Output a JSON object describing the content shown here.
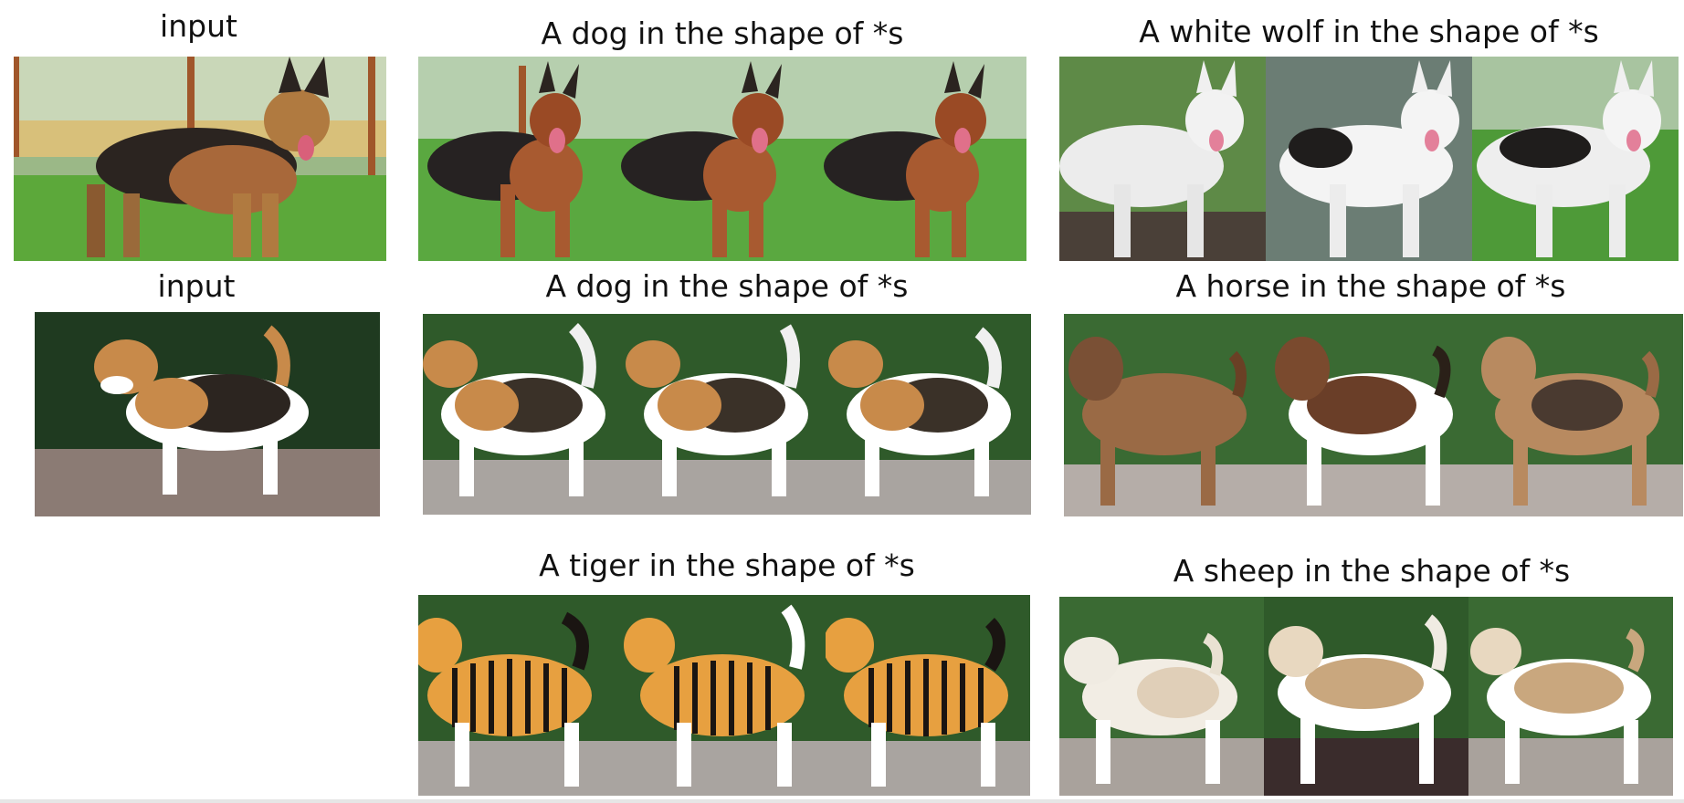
{
  "rows": [
    {
      "input_label": "input",
      "input_image": {
        "subject": "german-shepherd",
        "scene": "garden"
      },
      "groups": [
        {
          "caption": "A dog in the shape of *s",
          "subject": "german-shepherd",
          "scene": "garden",
          "coat": [
            "#2a2420",
            "#a85a30",
            "#c07040"
          ]
        },
        {
          "caption": "A white wolf in the shape of *s",
          "subject": "white-wolf",
          "scene": "mixed",
          "coat": [
            "#efefef",
            "#f5f5f5",
            "#222222"
          ]
        }
      ]
    },
    {
      "input_label": "input",
      "input_image": {
        "subject": "beagle",
        "scene": "park"
      },
      "groups": [
        {
          "caption": "A dog in the shape of *s",
          "subject": "beagle",
          "scene": "park",
          "coat": [
            "#ffffff",
            "#c88a4a",
            "#2c2520"
          ]
        },
        {
          "caption": "A horse in the shape of *s",
          "subject": "horse",
          "scene": "park",
          "coat": [
            "#9a6a45",
            "#b88a60",
            "#5a3a25"
          ]
        }
      ]
    },
    {
      "input_label": "",
      "input_image": null,
      "groups": [
        {
          "caption": "A tiger in the shape of *s",
          "subject": "tiger",
          "scene": "park",
          "coat": [
            "#e7a040",
            "#1a1512",
            "#ffffff"
          ]
        },
        {
          "caption": "A sheep in the shape of *s",
          "subject": "sheep",
          "scene": "park",
          "coat": [
            "#f2ede4",
            "#c9a77e",
            "#ffffff"
          ]
        }
      ]
    }
  ]
}
